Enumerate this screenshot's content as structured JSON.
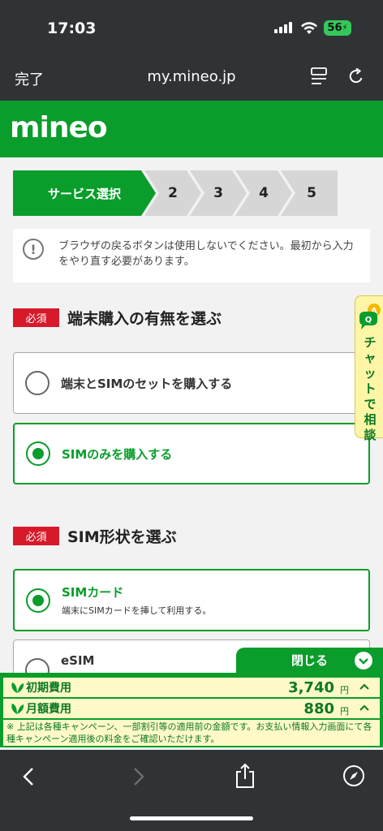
{
  "status_bar": {
    "time": "17:03",
    "battery": "56"
  },
  "browser": {
    "done_label": "完了",
    "url": "my.mineo.jp"
  },
  "site": {
    "logo": "mineo"
  },
  "steps": [
    "サービス選択",
    "2",
    "3",
    "4",
    "5"
  ],
  "notice": {
    "text": "ブラウザの戻るボタンは使用しないでください。最初から入力をやり直す必要があります。"
  },
  "section1": {
    "required": "必須",
    "title": "端末購入の有無を選ぶ",
    "options": [
      {
        "label": "端末とSIMのセットを購入する",
        "selected": false
      },
      {
        "label": "SIMのみを購入する",
        "selected": true
      }
    ]
  },
  "section2": {
    "required": "必須",
    "title": "SIM形状を選ぶ",
    "options": [
      {
        "label": "SIMカード",
        "sub": "端末にSIMカードを挿して利用する。",
        "selected": true
      },
      {
        "label": "eSIM",
        "selected": false
      }
    ]
  },
  "chat": {
    "label": "チャットで相談",
    "badge": "A"
  },
  "fees": {
    "close_label": "閉じる",
    "initial_label": "初期費用",
    "initial_value": "3,740",
    "monthly_label": "月額費用",
    "monthly_value": "880",
    "unit": "円",
    "note": "※ 上記は各種キャンペーン、一部割引等の適用前の金額です。お支払い情報入力画面にて各種キャンペーン適用後の料金をご確認いただけます。"
  },
  "colors": {
    "brand_green": "#0a9d2b",
    "required_red": "#d7192a",
    "chrome": "#2f3336"
  }
}
